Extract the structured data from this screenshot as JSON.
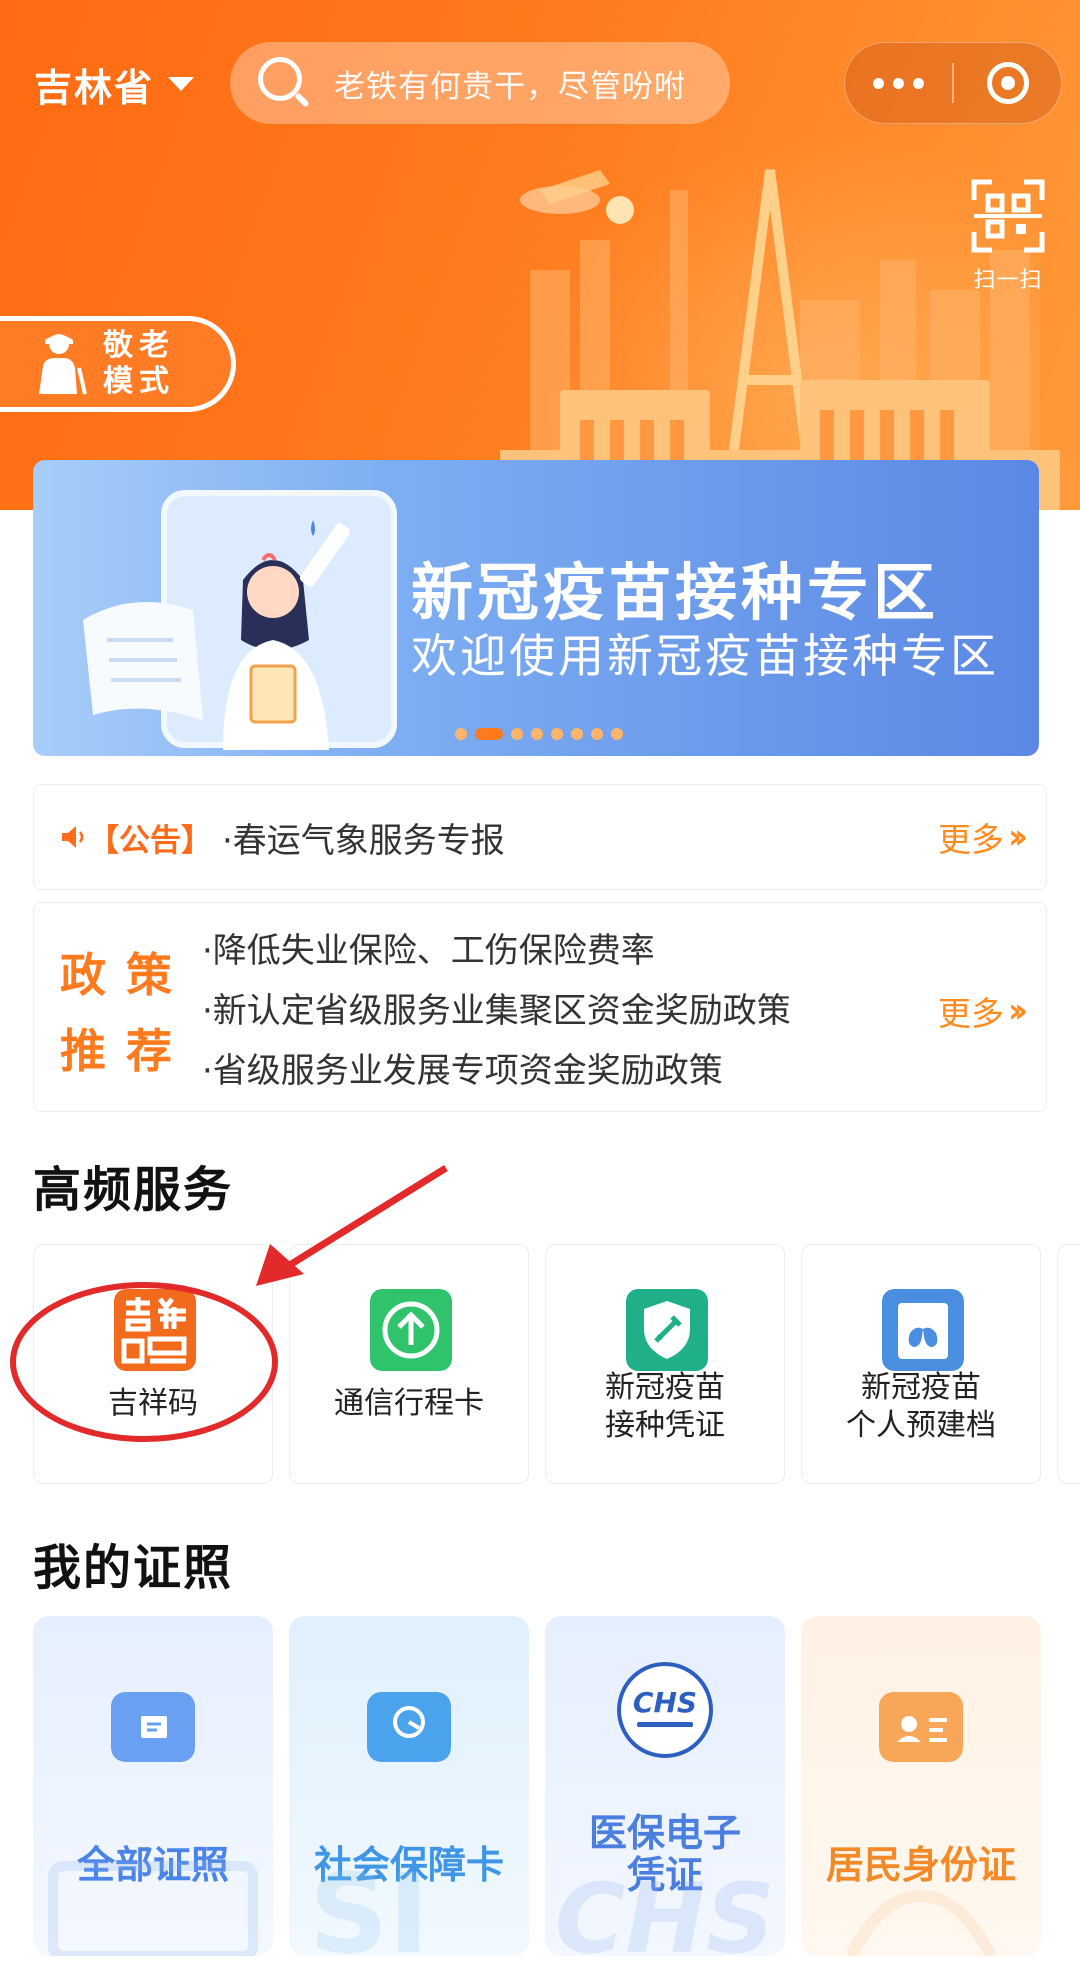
{
  "header": {
    "province": "吉林省",
    "search_placeholder": "老铁有何贵干，尽管吩咐",
    "scan_label": "扫一扫",
    "elder_mode_line1": "敬老",
    "elder_mode_line2": "模式"
  },
  "banner": {
    "title": "新冠疫苗接种专区",
    "subtitle": "欢迎使用新冠疫苗接种专区",
    "page_count": 8,
    "active_page": 2
  },
  "notice": {
    "tag": "【公告】",
    "title": "·春运气象服务专报",
    "more": "更多"
  },
  "policy": {
    "tag_line1": "政策",
    "tag_line2": "推荐",
    "items": [
      "·降低失业保险、工伤保险费率",
      "·新认定省级服务业集聚区资金奖励政策",
      "·省级服务业发展专项资金奖励政策"
    ],
    "more": "更多"
  },
  "services": {
    "title": "高频服务",
    "items": [
      {
        "name": "吉祥码",
        "icon": "jixiang-code-icon",
        "color": "#f26a1b"
      },
      {
        "name": "通信行程卡",
        "icon": "upload-arrow-icon",
        "color": "#2fc46b"
      },
      {
        "name": "新冠疫苗\n接种凭证",
        "icon": "vaccine-shield-icon",
        "color": "#1fb08a"
      },
      {
        "name": "新冠疫苗\n个人预建档",
        "icon": "lungs-icon",
        "color": "#4a8ee0"
      }
    ]
  },
  "licenses": {
    "title": "我的证照",
    "items": [
      {
        "name": "全部证照",
        "color": "#4a84e8"
      },
      {
        "name": "社会保障卡",
        "color": "#3f96e6"
      },
      {
        "name": "医保电子\n凭证",
        "color": "#4a7fe0"
      },
      {
        "name": "居民身份证",
        "color": "#f28a2a"
      }
    ]
  },
  "colors": {
    "accent": "#ff7a1c",
    "annotation": "#e32a2a"
  }
}
